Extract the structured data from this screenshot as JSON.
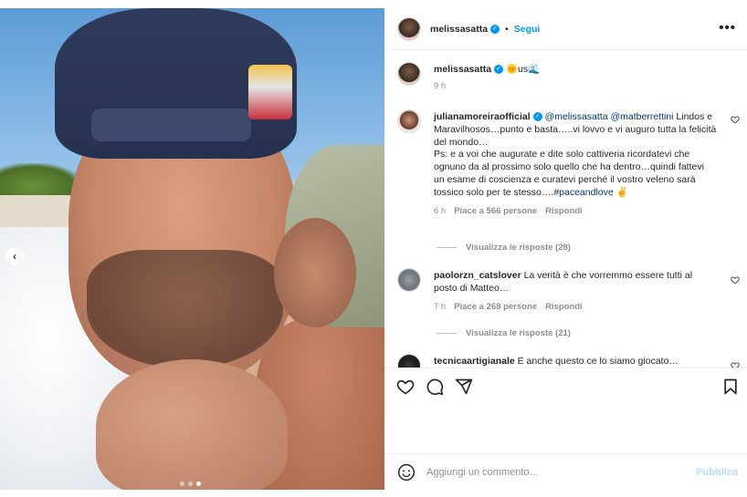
{
  "post": {
    "username": "melissasatta",
    "follow_label": "Segui",
    "more_label": "•••",
    "caption_suffix": "🌞us🌊",
    "caption_time": "9 h",
    "carousel_dots": 3,
    "carousel_active_index": 2
  },
  "comments": [
    {
      "username": "julianamoreiraofficial",
      "verified": true,
      "text_parts": [
        {
          "type": "mention",
          "text": "@melissasatta"
        },
        {
          "type": "text",
          "text": " "
        },
        {
          "type": "mention",
          "text": "@matberrettini"
        },
        {
          "type": "text",
          "text": " Lindos e Maravilhosos…punto e basta…..vi lovvo e vi auguro tutta la felicità del mondo…"
        }
      ],
      "text_line2": "Ps: e a voi che augurate e dite solo cattiveria ricordatevi che ognuno da al prossimo solo quello che ha dentro…quindi fattevi un esame di coscienza e curatevi perché il vostro veleno sarà tossico solo per te stesso….",
      "hashtag": "#paceandlove",
      "hashtag_suffix": " ✌",
      "time": "6 h",
      "likes": "Piace a 566 persone",
      "reply_label": "Rispondi",
      "view_replies": "Visualizza le risposte (28)"
    },
    {
      "username": "paolorzn_catslover",
      "verified": false,
      "text": "La verità è che vorremmo essere tutti al posto di Matteo…",
      "time": "7 h",
      "likes": "Piace a 268 persone",
      "reply_label": "Rispondi",
      "view_replies": "Visualizza le risposte (21)"
    },
    {
      "username": "tecnicaartigianale",
      "verified": false,
      "text": "E anche questo ce lo siamo giocato…"
    }
  ],
  "composer": {
    "placeholder": "Aggiungi un commento...",
    "publish_label": "Pubblica"
  },
  "colors": {
    "accent": "#0095f6",
    "publish_disabled": "#b2dffc",
    "mention": "#00376b",
    "muted": "#8e8e8e"
  },
  "icons": [
    "heart-icon",
    "comment-icon",
    "share-icon",
    "bookmark-icon",
    "emoji-icon",
    "chevron-left-icon",
    "more-icon",
    "verified-badge-icon"
  ]
}
